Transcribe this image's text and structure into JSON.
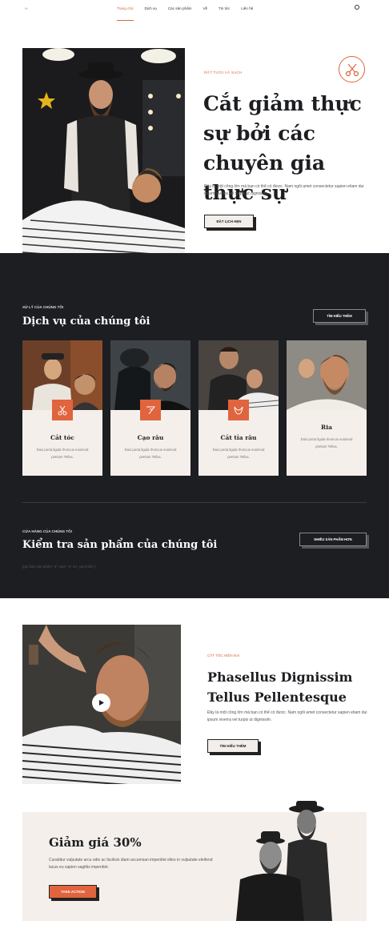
{
  "nav": {
    "logo": "W",
    "items": [
      "Trang chủ",
      "Dịch vụ",
      "Các sản phẩm",
      "Về",
      "Tin tức",
      "Liên hệ"
    ]
  },
  "hero": {
    "eyebrow": "RẤT TƯƠI VÀ SẠCH",
    "title": "Cắt giảm thực sự bởi các chuyên gia thực sự",
    "text": "Đây là một công lớn mà bạn có thể có được. Nam ngôi amet consectetur sapien etiam dui ipsum viverra vel turpis ut dignissim.",
    "button": "ĐẶT LỊCH HẸN"
  },
  "services": {
    "eyebrow": "XỬ LÝ CỦA CHÚNG TÔI",
    "title": "Dịch vụ của chúng tôi",
    "button": "TÌM HIỂU THÊM",
    "cards": [
      {
        "title": "Cắt tóc",
        "desc": "Duis porta ligula rhoncus euismod pretium Tellus.",
        "icon": "scissors-icon"
      },
      {
        "title": "Cạo râu",
        "desc": "Duis porta ligula rhoncus euismod pretium Tellus.",
        "icon": "razor-icon"
      },
      {
        "title": "Cắt tỉa râu",
        "desc": "Duis porta ligula rhoncus euismod pretium Tellus.",
        "icon": "beard-icon"
      },
      {
        "title": "Ria",
        "desc": "Duis porta ligula rhoncus euismod pretium Tellus."
      }
    ]
  },
  "shop": {
    "eyebrow": "CỬA HÀNG CỦA CHÚNG TÔI",
    "title": "Kiểm tra sản phẩm của chúng tôi",
    "button": "NHIỀU SẢN PHẨM HƠN",
    "note": "[gói hàn sản phẩm \"6\" cách \"4\" cơ_sạch tiêu\"]"
  },
  "modern": {
    "eyebrow": "CẮT TÓC HIỆN ĐẠI",
    "title": "Phasellus Dignissim Tellus Pellentesque",
    "text": "Đây là một công lớn mà bạn có thể có được. Nam ngôi amet consectetur sapien etiam dui ipsum viverra vel turpis ut dignissim.",
    "button": "TÌM HIỂU THÊM"
  },
  "promo": {
    "title": "Giảm giá 30%",
    "text": "Curabitur vulputate arcu odio ac facilisis diam accumsan imperdiet elleo in vulputate eleifend lacus eu sapien sagittis imperdiet.",
    "button": "TAKE ACTION"
  },
  "colors": {
    "accent": "#e0643d",
    "dark": "#1c1e21",
    "cream": "#f5efec"
  }
}
